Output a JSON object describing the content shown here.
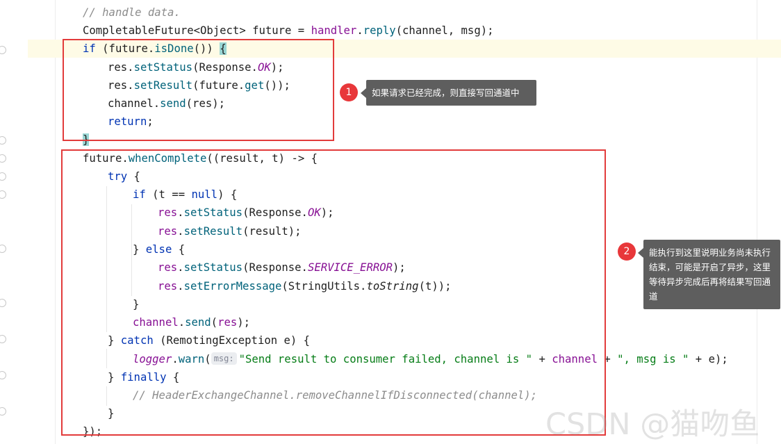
{
  "editor": {
    "code": {
      "l1_comment": "// handle data.",
      "l2_type": "CompletableFuture<Object> future = ",
      "l2_handler": "handler",
      "l2_dot": ".",
      "l2_reply": "reply",
      "l2_args": "(channel, msg);",
      "l3_if": "if",
      "l3_open": " (future.",
      "l3_isdone": "isDone",
      "l3_close": "()) ",
      "l3_brace": "{",
      "l4_a": "res.",
      "l4_b": "setStatus",
      "l4_c": "(Response.",
      "l4_d": "OK",
      "l4_e": ");",
      "l5_a": "res.",
      "l5_b": "setResult",
      "l5_c": "(future.",
      "l5_d": "get",
      "l5_e": "());",
      "l6_a": "channel.",
      "l6_b": "send",
      "l6_c": "(res);",
      "l7_return": "return",
      "l7_semi": ";",
      "l8_brace": "}",
      "l9_a": "future.",
      "l9_b": "whenComplete",
      "l9_c": "((result, t) -> {",
      "l10_try": "try",
      "l10_b": " {",
      "l11_if": "if",
      "l11_b": " (t == ",
      "l11_null": "null",
      "l11_c": ") {",
      "l12_res": "res",
      "l12_b": ".",
      "l12_fn": "setStatus",
      "l12_c": "(Response.",
      "l12_ok": "OK",
      "l12_d": ");",
      "l13_res": "res",
      "l13_b": ".",
      "l13_fn": "setResult",
      "l13_c": "(result);",
      "l14_a": "} ",
      "l14_else": "else",
      "l14_b": " {",
      "l15_res": "res",
      "l15_b": ".",
      "l15_fn": "setStatus",
      "l15_c": "(Response.",
      "l15_err": "SERVICE_ERROR",
      "l15_d": ");",
      "l16_res": "res",
      "l16_b": ".",
      "l16_fn": "setErrorMessage",
      "l16_c": "(StringUtils.",
      "l16_ts": "toString",
      "l16_d": "(t));",
      "l17": "}",
      "l18_ch": "channel",
      "l18_b": ".",
      "l18_fn": "send",
      "l18_c": "(",
      "l18_res": "res",
      "l18_d": ");",
      "l19_a": "} ",
      "l19_catch": "catch",
      "l19_b": " (RemotingException e) {",
      "l20_logger": "logger",
      "l20_b": ".",
      "l20_warn": "warn",
      "l20_c": "(",
      "l20_hint": "msg:",
      "l20_str1": "\"Send result to consumer failed, channel is \"",
      "l20_d": " + ",
      "l20_ch": "channel",
      "l20_e": " + ",
      "l20_str2": "\", msg is \"",
      "l20_f": " + e);",
      "l21_a": "} ",
      "l21_finally": "finally",
      "l21_b": " {",
      "l22_comment": "// HeaderExchangeChannel.removeChannelIfDisconnected(channel);",
      "l23": "}",
      "l24": "});"
    }
  },
  "annotations": [
    {
      "number": "1",
      "text": "如果请求已经完成，则直接写回通道中"
    },
    {
      "number": "2",
      "text": "能执行到这里说明业务尚未执行结束，可能是开启了异步，这里等待异步完成后再将结果写回通道"
    }
  ],
  "watermark": "CSDN @猫吻鱼",
  "colors": {
    "keyword": "#0033b3",
    "method": "#00627a",
    "field": "#871094",
    "string": "#067d17",
    "comment": "#8c8c8c",
    "annotation_box": "#e23b3b",
    "badge": "#e8373a",
    "tooltip": "#5e5e5e"
  }
}
